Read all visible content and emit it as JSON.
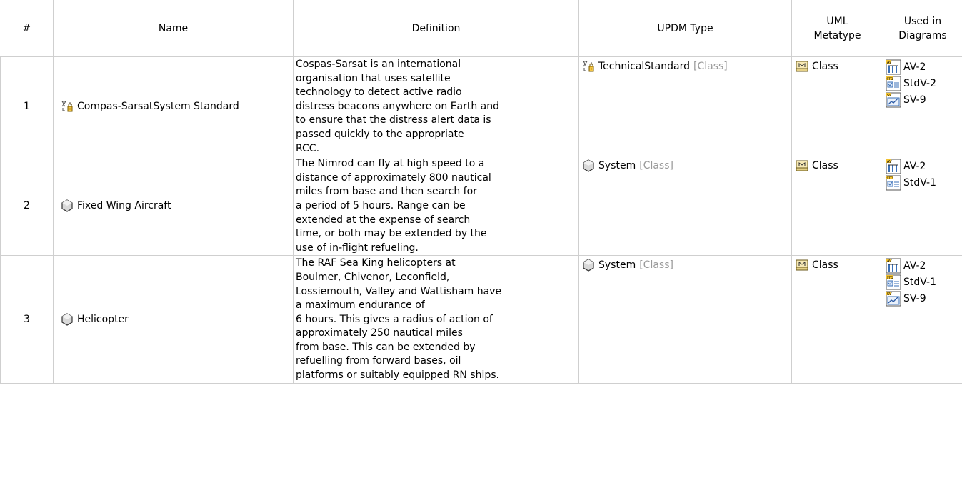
{
  "headers": {
    "num": "#",
    "name": "Name",
    "definition": "Definition",
    "updm_type": "UPDM Type",
    "uml_metatype_l1": "UML",
    "uml_metatype_l2": "Metatype",
    "used_l1": "Used in",
    "used_l2": "Diagrams"
  },
  "rows": [
    {
      "num": "1",
      "name": "Compas-SarsatSystem Standard",
      "name_icon": "technical-standard-icon",
      "definition_lines": [
        "Cospas-Sarsat is an international",
        "organisation that uses satellite",
        "technology to detect active radio",
        "distress beacons anywhere on Earth and",
        "to ensure that the distress alert data is",
        "passed quickly to the appropriate",
        "RCC."
      ],
      "updm_type": "TechnicalStandard",
      "updm_type_icon": "technical-standard-icon",
      "updm_suffix": "[Class]",
      "metatype": "Class",
      "diagrams": [
        {
          "label": "AV-2",
          "icon": "av-diagram-icon"
        },
        {
          "label": "StdV-2",
          "icon": "stdv-diagram-icon"
        },
        {
          "label": "SV-9",
          "icon": "sv-diagram-icon"
        }
      ]
    },
    {
      "num": "2",
      "name": "Fixed Wing Aircraft",
      "name_icon": "system-icon",
      "definition_lines": [
        "The Nimrod can fly at high speed to a",
        "distance of approximately 800 nautical",
        "miles from base and then search for",
        "a period of 5 hours. Range can be",
        "extended at the expense of search",
        "time, or both may be extended by the",
        "use of in-flight refueling."
      ],
      "updm_type": "System",
      "updm_type_icon": "system-icon",
      "updm_suffix": "[Class]",
      "metatype": "Class",
      "diagrams": [
        {
          "label": "AV-2",
          "icon": "av-diagram-icon"
        },
        {
          "label": "StdV-1",
          "icon": "stdv-diagram-icon"
        }
      ]
    },
    {
      "num": "3",
      "name": "Helicopter",
      "name_icon": "system-icon",
      "definition_lines": [
        "The RAF Sea King helicopters at",
        "Boulmer, Chivenor, Leconfield,",
        "Lossiemouth, Valley and Wattisham have",
        "a maximum endurance of",
        "6 hours. This gives a radius of action of",
        "approximately 250 nautical miles",
        "from base. This can be extended by",
        "refuelling from forward bases, oil",
        "platforms or suitably equipped RN ships."
      ],
      "updm_type": "System",
      "updm_type_icon": "system-icon",
      "updm_suffix": "[Class]",
      "metatype": "Class",
      "diagrams": [
        {
          "label": "AV-2",
          "icon": "av-diagram-icon"
        },
        {
          "label": "StdV-1",
          "icon": "stdv-diagram-icon"
        },
        {
          "label": "SV-9",
          "icon": "sv-diagram-icon"
        }
      ]
    }
  ]
}
